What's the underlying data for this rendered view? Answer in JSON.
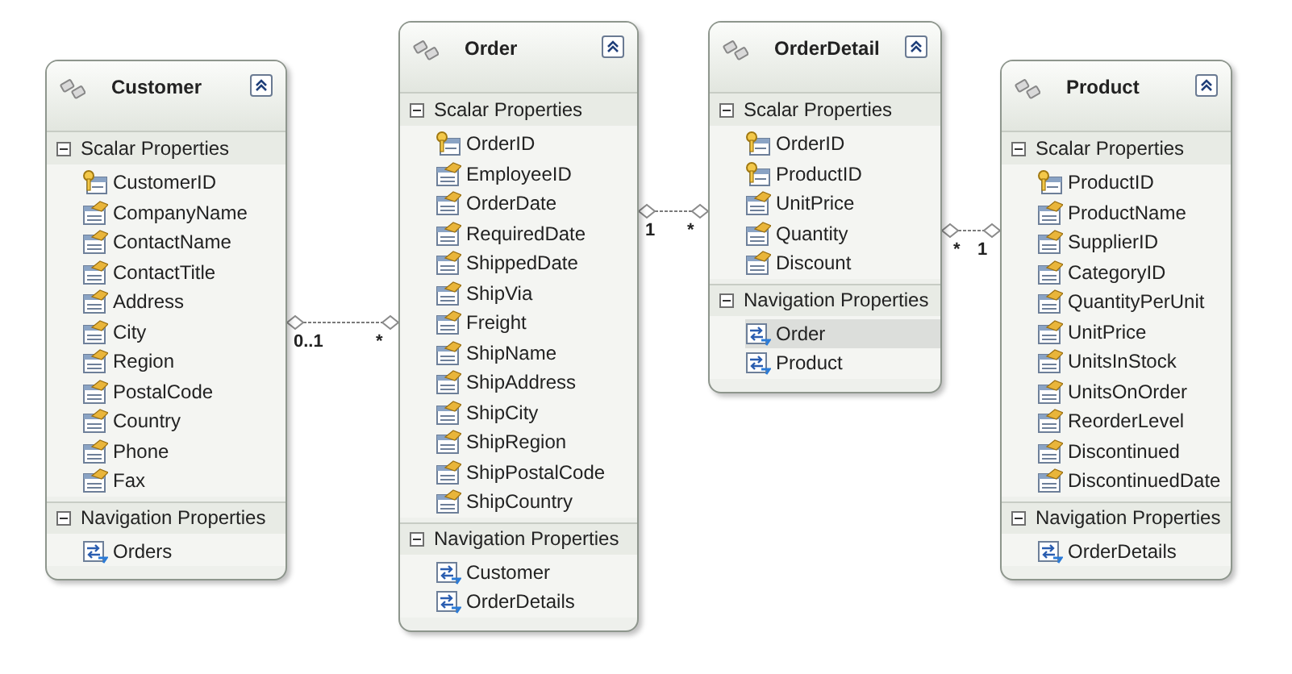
{
  "entities": [
    {
      "name": "Customer",
      "sections": [
        {
          "title": "Scalar Properties",
          "expanded": true,
          "kind": "scalar",
          "items": [
            {
              "name": "CustomerID",
              "key": true
            },
            {
              "name": "CompanyName",
              "key": false
            },
            {
              "name": "ContactName",
              "key": false
            },
            {
              "name": "ContactTitle",
              "key": false
            },
            {
              "name": "Address",
              "key": false
            },
            {
              "name": "City",
              "key": false
            },
            {
              "name": "Region",
              "key": false
            },
            {
              "name": "PostalCode",
              "key": false
            },
            {
              "name": "Country",
              "key": false
            },
            {
              "name": "Phone",
              "key": false
            },
            {
              "name": "Fax",
              "key": false
            }
          ]
        },
        {
          "title": "Navigation Properties",
          "expanded": true,
          "kind": "navigation",
          "items": [
            {
              "name": "Orders",
              "selected": false
            }
          ]
        }
      ]
    },
    {
      "name": "Order",
      "sections": [
        {
          "title": "Scalar Properties",
          "expanded": true,
          "kind": "scalar",
          "items": [
            {
              "name": "OrderID",
              "key": true
            },
            {
              "name": "EmployeeID",
              "key": false
            },
            {
              "name": "OrderDate",
              "key": false
            },
            {
              "name": "RequiredDate",
              "key": false
            },
            {
              "name": "ShippedDate",
              "key": false
            },
            {
              "name": "ShipVia",
              "key": false
            },
            {
              "name": "Freight",
              "key": false
            },
            {
              "name": "ShipName",
              "key": false
            },
            {
              "name": "ShipAddress",
              "key": false
            },
            {
              "name": "ShipCity",
              "key": false
            },
            {
              "name": "ShipRegion",
              "key": false
            },
            {
              "name": "ShipPostalCode",
              "key": false
            },
            {
              "name": "ShipCountry",
              "key": false
            }
          ]
        },
        {
          "title": "Navigation Properties",
          "expanded": true,
          "kind": "navigation",
          "items": [
            {
              "name": "Customer",
              "selected": false
            },
            {
              "name": "OrderDetails",
              "selected": false
            }
          ]
        }
      ]
    },
    {
      "name": "OrderDetail",
      "sections": [
        {
          "title": "Scalar Properties",
          "expanded": true,
          "kind": "scalar",
          "items": [
            {
              "name": "OrderID",
              "key": true
            },
            {
              "name": "ProductID",
              "key": true
            },
            {
              "name": "UnitPrice",
              "key": false
            },
            {
              "name": "Quantity",
              "key": false
            },
            {
              "name": "Discount",
              "key": false
            }
          ]
        },
        {
          "title": "Navigation Properties",
          "expanded": true,
          "kind": "navigation",
          "items": [
            {
              "name": "Order",
              "selected": true
            },
            {
              "name": "Product",
              "selected": false
            }
          ]
        }
      ]
    },
    {
      "name": "Product",
      "sections": [
        {
          "title": "Scalar Properties",
          "expanded": true,
          "kind": "scalar",
          "items": [
            {
              "name": "ProductID",
              "key": true
            },
            {
              "name": "ProductName",
              "key": false
            },
            {
              "name": "SupplierID",
              "key": false
            },
            {
              "name": "CategoryID",
              "key": false
            },
            {
              "name": "QuantityPerUnit",
              "key": false
            },
            {
              "name": "UnitPrice",
              "key": false
            },
            {
              "name": "UnitsInStock",
              "key": false
            },
            {
              "name": "UnitsOnOrder",
              "key": false
            },
            {
              "name": "ReorderLevel",
              "key": false
            },
            {
              "name": "Discontinued",
              "key": false
            },
            {
              "name": "DiscontinuedDate",
              "key": false
            }
          ]
        },
        {
          "title": "Navigation Properties",
          "expanded": true,
          "kind": "navigation",
          "items": [
            {
              "name": "OrderDetails",
              "selected": false
            }
          ]
        }
      ]
    }
  ],
  "associations": [
    {
      "end_1": "0..1",
      "end_2": "*"
    },
    {
      "end_1": "1",
      "end_2": "*"
    },
    {
      "end_1": "*",
      "end_2": "1"
    }
  ]
}
